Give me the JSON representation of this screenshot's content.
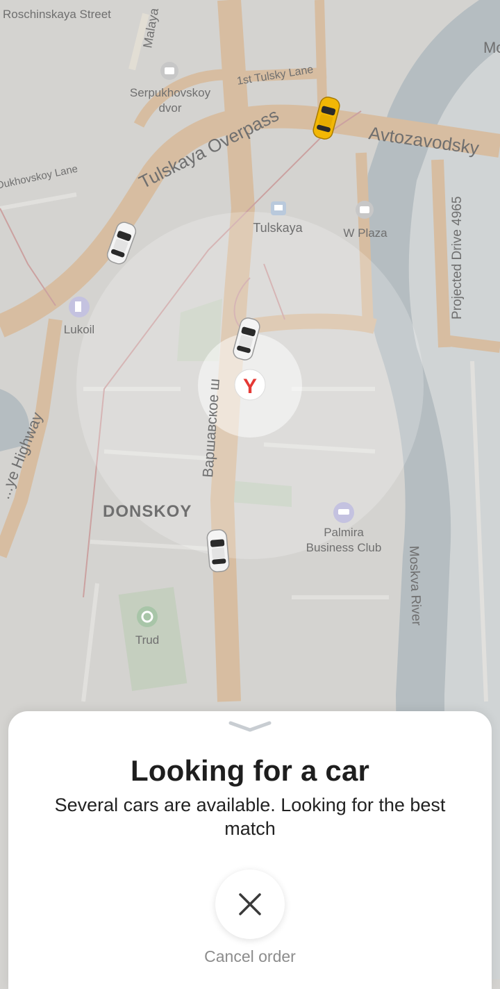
{
  "map": {
    "streets": {
      "roschinskaya": "Roschinskaya Street",
      "malaya": "Malaya",
      "tulsky_lane": "1st Tulsky Lane",
      "overpass": "Tulskaya Overpass",
      "avtozavodsky": "Avtozavodsky",
      "dukhovskoy": "Dukhovskoy Lane",
      "projected_drive": "Projected Drive 4965",
      "highway": "...ye Highway",
      "varshavskoe": "Варшавское ш",
      "moskva_river": "Moskva River"
    },
    "pois": {
      "serpukhovskoy_line1": "Serpukhovskoy",
      "serpukhovskoy_line2": "dvor",
      "tulskaya": "Tulskaya",
      "w_plaza": "W Plaza",
      "lukoil": "Lukoil",
      "donskoy": "DONSKOY",
      "palmira_line1": "Palmira",
      "palmira_line2": "Business Club",
      "trud": "Trud",
      "mo": "Mo"
    },
    "pickup_marker_letter": "Y",
    "colors": {
      "map_bg": "#d4d3d0",
      "road": "#d9b58f",
      "river": "#a9b4bb",
      "park": "#bfcdb9",
      "taxi_yellow": "#f2b705",
      "marker_red": "#e53935"
    }
  },
  "sheet": {
    "title": "Looking for a car",
    "subtitle": "Several cars are available. Looking for the best match",
    "cancel_label": "Cancel order",
    "cancel_icon": "close-icon",
    "handle_icon": "chevron-down-icon"
  }
}
